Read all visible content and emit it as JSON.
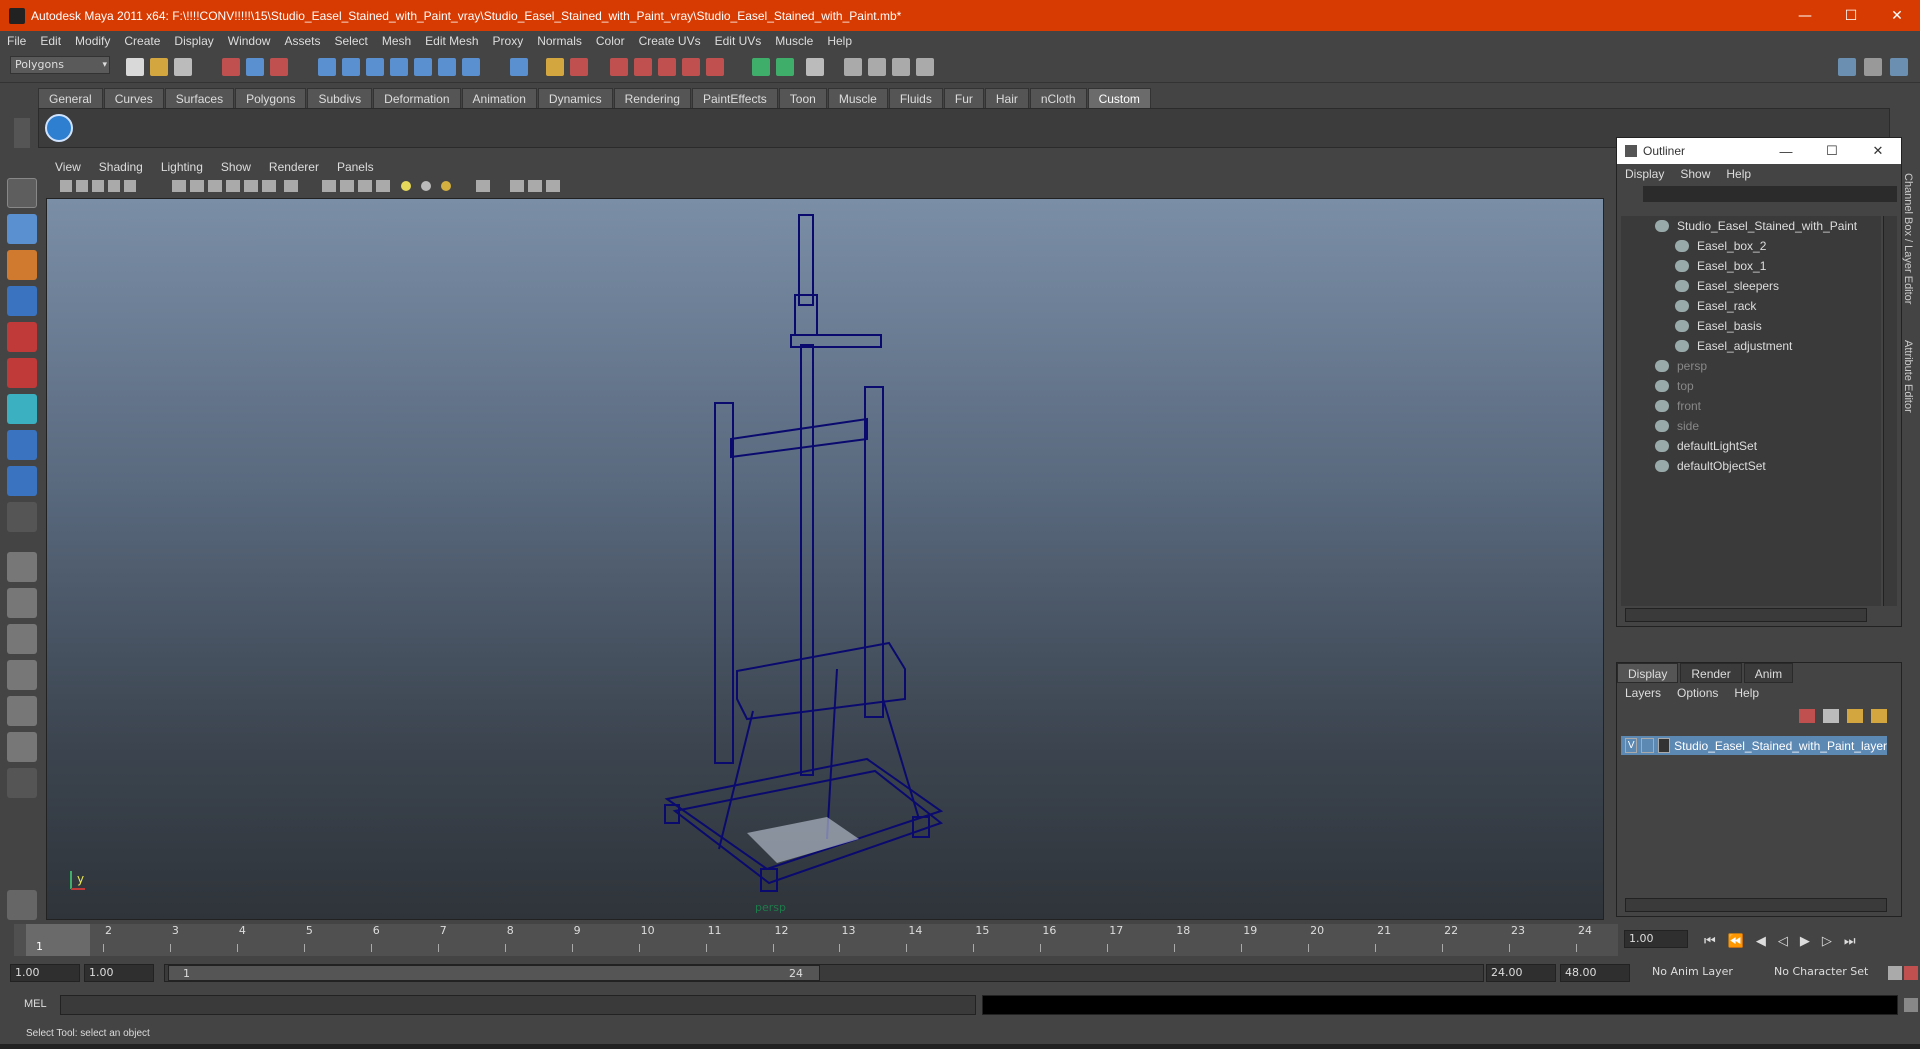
{
  "window": {
    "title": "Autodesk Maya 2011 x64: F:\\!!!!CONV!!!!!\\15\\Studio_Easel_Stained_with_Paint_vray\\Studio_Easel_Stained_with_Paint_vray\\Studio_Easel_Stained_with_Paint.mb*",
    "minimize": "—",
    "maximize": "☐",
    "close": "✕"
  },
  "menubar": [
    "File",
    "Edit",
    "Modify",
    "Create",
    "Display",
    "Window",
    "Assets",
    "Select",
    "Mesh",
    "Edit Mesh",
    "Proxy",
    "Normals",
    "Color",
    "Create UVs",
    "Edit UVs",
    "Muscle",
    "Help"
  ],
  "toolbar": {
    "mode": "Polygons",
    "mode_arrow": "▾"
  },
  "shelf": {
    "tabs": [
      "General",
      "Curves",
      "Surfaces",
      "Polygons",
      "Subdivs",
      "Deformation",
      "Animation",
      "Dynamics",
      "Rendering",
      "PaintEffects",
      "Toon",
      "Muscle",
      "Fluids",
      "Fur",
      "Hair",
      "nCloth",
      "Custom"
    ],
    "active": "Custom"
  },
  "viewport": {
    "menu": [
      "View",
      "Shading",
      "Lighting",
      "Show",
      "Renderer",
      "Panels"
    ],
    "camera_label": "persp",
    "wire_color": "#0a0a6e",
    "axis_y": "y",
    "axis_x": "x"
  },
  "outliner": {
    "title": "Outliner",
    "menu": [
      "Display",
      "Show",
      "Help"
    ],
    "items": [
      {
        "label": "Studio_Easel_Stained_with_Paint",
        "indent": 0,
        "dim": false
      },
      {
        "label": "Easel_box_2",
        "indent": 1,
        "dim": false
      },
      {
        "label": "Easel_box_1",
        "indent": 1,
        "dim": false
      },
      {
        "label": "Easel_sleepers",
        "indent": 1,
        "dim": false
      },
      {
        "label": "Easel_rack",
        "indent": 1,
        "dim": false
      },
      {
        "label": "Easel_basis",
        "indent": 1,
        "dim": false
      },
      {
        "label": "Easel_adjustment",
        "indent": 1,
        "dim": false
      },
      {
        "label": "persp",
        "indent": 0,
        "dim": true
      },
      {
        "label": "top",
        "indent": 0,
        "dim": true
      },
      {
        "label": "front",
        "indent": 0,
        "dim": true
      },
      {
        "label": "side",
        "indent": 0,
        "dim": true
      },
      {
        "label": "defaultLightSet",
        "indent": 0,
        "dim": false
      },
      {
        "label": "defaultObjectSet",
        "indent": 0,
        "dim": false
      }
    ]
  },
  "layer_editor": {
    "tabs": [
      "Display",
      "Render",
      "Anim"
    ],
    "active": "Display",
    "menu": [
      "Layers",
      "Options",
      "Help"
    ],
    "layer_visible": "V",
    "layer_name": "Studio_Easel_Stained_with_Paint_layer"
  },
  "side_tabs": [
    "Channel Box / Layer Editor",
    "Attribute Editor"
  ],
  "timeline": {
    "ticks": [
      "1",
      "2",
      "3",
      "4",
      "5",
      "6",
      "7",
      "8",
      "9",
      "10",
      "11",
      "12",
      "13",
      "14",
      "15",
      "16",
      "17",
      "18",
      "19",
      "20",
      "21",
      "22",
      "23",
      "24"
    ],
    "current": "1",
    "current_field": "1.00"
  },
  "range": {
    "start": "1.00",
    "playback_start": "1.00",
    "slider_start": "1",
    "slider_end": "24",
    "playback_end": "24.00",
    "end": "48.00",
    "anim_layer": "No Anim Layer",
    "character_set": "No Character Set"
  },
  "command": {
    "label": "MEL"
  },
  "status": {
    "help_line": "Select Tool: select an object"
  }
}
